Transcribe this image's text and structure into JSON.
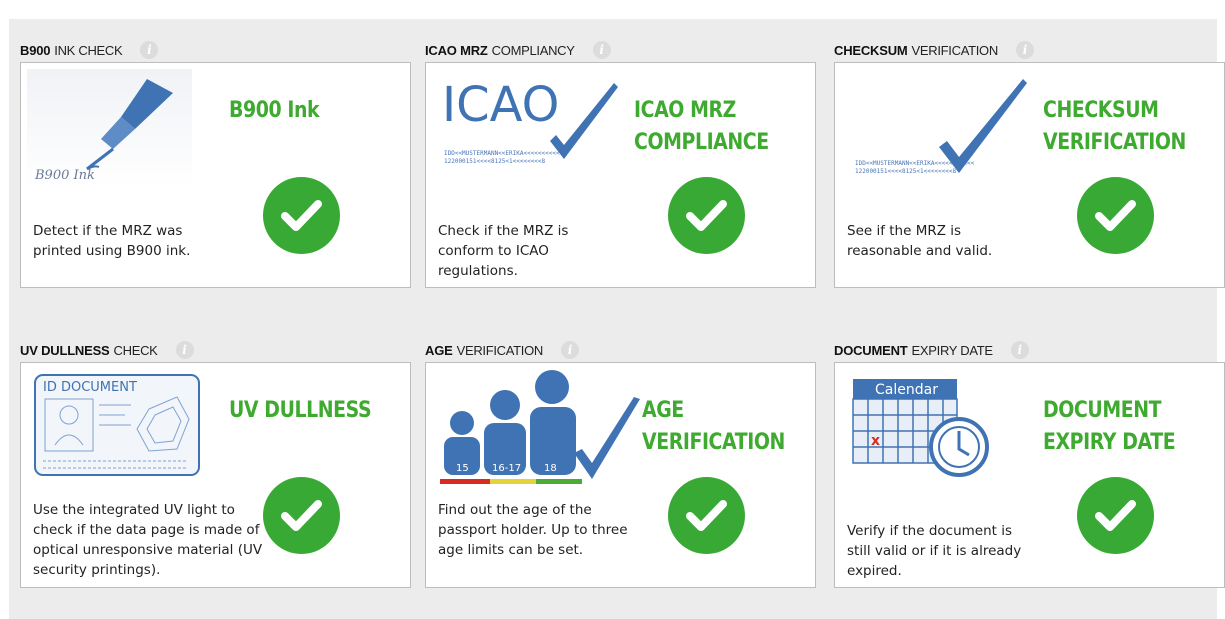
{
  "cards": [
    {
      "id": "b900",
      "head_strong": "B900",
      "head_light": "INK CHECK",
      "title_lines": [
        "B900 Ink"
      ],
      "desc": "Detect if the MRZ was printed using B900 ink.",
      "illustration_text": "B900 Ink",
      "status": "passed"
    },
    {
      "id": "icao",
      "head_strong": "ICAO MRZ",
      "head_light": "COMPLIANCY",
      "title_lines": [
        "ICAO MRZ",
        "COMPLIANCE"
      ],
      "desc": "Check if the MRZ is conform to ICAO regulations.",
      "illustration_text": "ICAO",
      "status": "passed"
    },
    {
      "id": "checksum",
      "head_strong": "CHECKSUM",
      "head_light": "VERIFICATION",
      "title_lines": [
        "CHECKSUM",
        "VERIFICATION"
      ],
      "desc": "See if the MRZ is reasonable and valid.",
      "status": "passed"
    },
    {
      "id": "uv",
      "head_strong": "UV DULLNESS",
      "head_light": "CHECK",
      "title_lines": [
        "UV DULLNESS"
      ],
      "desc": "Use the integrated UV light to check if the data page is made of optical unresponsive material (UV security printings).",
      "illustration_text": "ID DOCUMENT",
      "status": "passed"
    },
    {
      "id": "age",
      "head_strong": "AGE",
      "head_light": "VERIFICATION",
      "title_lines": [
        "AGE",
        "VERIFICATION"
      ],
      "desc": "Find out the age of the passport holder. Up to three age limits can be set.",
      "age_labels": [
        "15",
        "16-17",
        "18"
      ],
      "status": "passed"
    },
    {
      "id": "expiry",
      "head_strong": "DOCUMENT",
      "head_light": "EXPIRY DATE",
      "title_lines": [
        "DOCUMENT",
        "EXPIRY DATE"
      ],
      "desc": "Verify if the document is still valid or if it is already expired.",
      "illustration_text": "Calendar",
      "status": "passed"
    }
  ],
  "colors": {
    "title_green": "#3eaa2f",
    "check_green": "#39a935",
    "illustration_blue": "#3f73b4",
    "panel_bg": "#ececec"
  }
}
